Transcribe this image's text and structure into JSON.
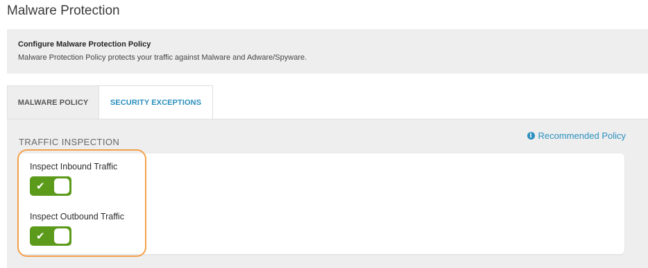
{
  "page": {
    "title": "Malware Protection"
  },
  "banner": {
    "title": "Configure Malware Protection Policy",
    "description": "Malware Protection Policy protects your traffic against Malware and Adware/Spyware."
  },
  "tabs": [
    {
      "label": "MALWARE POLICY",
      "active": true
    },
    {
      "label": "SECURITY EXCEPTIONS",
      "active": false
    }
  ],
  "section": {
    "title": "TRAFFIC INSPECTION",
    "recommended_link": "Recommended Policy",
    "recommended_icon": "info-circle-icon"
  },
  "settings": [
    {
      "label": "Inspect Inbound Traffic",
      "enabled": true,
      "icon": "check-icon"
    },
    {
      "label": "Inspect Outbound Traffic",
      "enabled": true,
      "icon": "check-icon"
    }
  ],
  "colors": {
    "accent_blue": "#2a8fbd",
    "toggle_on": "#5b9a1a",
    "highlight_outline": "#f5a04b",
    "panel_bg": "#eeeeee"
  }
}
